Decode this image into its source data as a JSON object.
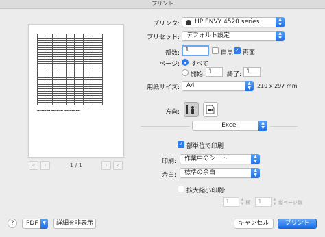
{
  "window": {
    "title": "プリント"
  },
  "preview": {
    "page_indicator": "1 / 1",
    "first_glyph": "«",
    "prev_glyph": "‹",
    "next_glyph": "›",
    "last_glyph": "»"
  },
  "printer": {
    "label": "プリンタ:",
    "value": "HP ENVY 4520 series"
  },
  "presets": {
    "label": "プリセット:",
    "value": "デフォルト設定"
  },
  "copies": {
    "label": "部数:",
    "value": "1",
    "bw_label": "白黒",
    "bw_checked": false,
    "duplex_label": "両面",
    "duplex_checked": true
  },
  "pages": {
    "label": "ページ:",
    "all_label": "すべて",
    "range_from_label": "開始:",
    "range_from_value": "1",
    "range_to_label": "終了:",
    "range_to_value": "1"
  },
  "paper": {
    "label": "用紙サイズ:",
    "value": "A4",
    "dimensions": "210 x 297 mm"
  },
  "orientation": {
    "label": "方向:",
    "portrait_icon": "portrait-orientation-icon",
    "landscape_icon": "landscape-orientation-icon",
    "selected": "portrait"
  },
  "section": {
    "value": "Excel"
  },
  "excel": {
    "print_per_copy_label": "部単位で印刷",
    "print_per_copy_checked": true,
    "print_what_label": "印刷:",
    "print_what_value": "作業中のシート",
    "margins_label": "余白:",
    "margins_value": "標準の余白",
    "scale_label": "拡大縮小印刷:",
    "scale_checked": false,
    "scale_from_value": "1",
    "scale_across_label": "横",
    "scale_to_value": "1",
    "scale_down_label": "縦ページ数"
  },
  "footer": {
    "help_glyph": "?",
    "pdf_label": "PDF",
    "hide_details_label": "詳細を非表示",
    "cancel_label": "キャンセル",
    "print_label": "プリント"
  },
  "colors": {
    "accent": "#1d6fe8",
    "background": "#ececec"
  }
}
